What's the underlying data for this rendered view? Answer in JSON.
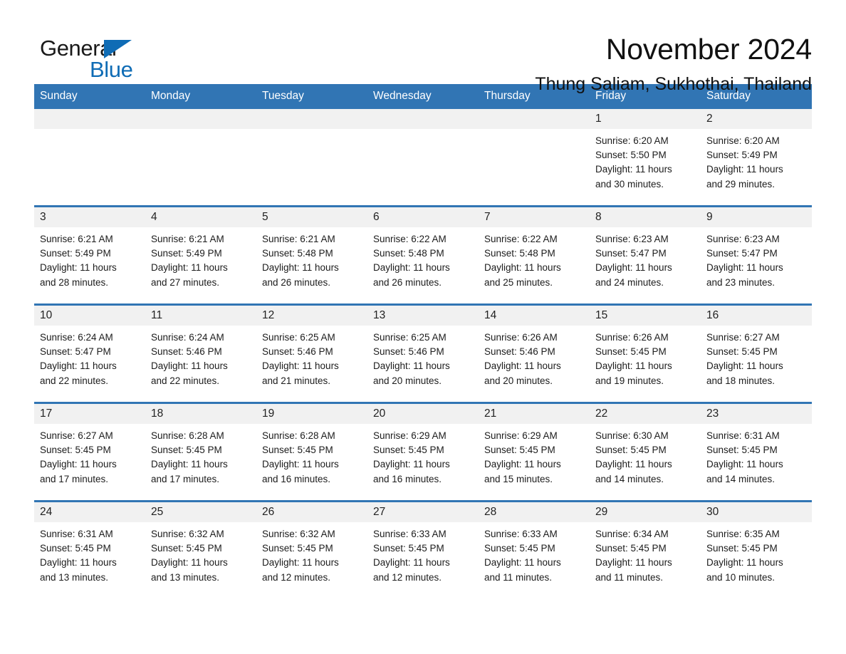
{
  "logo": {
    "word_general": "General",
    "word_blue": "Blue",
    "triangle_color": "#0f6cb5"
  },
  "header": {
    "month_title": "November 2024",
    "location": "Thung Saliam, Sukhothai, Thailand"
  },
  "theme": {
    "header_blue": "#3175b4",
    "daynum_band": "#f1f1f1",
    "row_divider": "#3175b4",
    "text": "#1c1c1c",
    "page_background": "#ffffff"
  },
  "calendar": {
    "weekday_headers": [
      "Sunday",
      "Monday",
      "Tuesday",
      "Wednesday",
      "Thursday",
      "Friday",
      "Saturday"
    ],
    "labels": {
      "sunrise_prefix": "Sunrise:",
      "sunset_prefix": "Sunset:",
      "daylight_prefix": "Daylight:"
    },
    "weeks": [
      [
        {
          "day": "",
          "blank": true
        },
        {
          "day": "",
          "blank": true
        },
        {
          "day": "",
          "blank": true
        },
        {
          "day": "",
          "blank": true
        },
        {
          "day": "",
          "blank": true
        },
        {
          "day": "1",
          "sunrise": "Sunrise: 6:20 AM",
          "sunset": "Sunset: 5:50 PM",
          "daylight_line1": "Daylight: 11 hours",
          "daylight_line2": "and 30 minutes."
        },
        {
          "day": "2",
          "sunrise": "Sunrise: 6:20 AM",
          "sunset": "Sunset: 5:49 PM",
          "daylight_line1": "Daylight: 11 hours",
          "daylight_line2": "and 29 minutes."
        }
      ],
      [
        {
          "day": "3",
          "sunrise": "Sunrise: 6:21 AM",
          "sunset": "Sunset: 5:49 PM",
          "daylight_line1": "Daylight: 11 hours",
          "daylight_line2": "and 28 minutes."
        },
        {
          "day": "4",
          "sunrise": "Sunrise: 6:21 AM",
          "sunset": "Sunset: 5:49 PM",
          "daylight_line1": "Daylight: 11 hours",
          "daylight_line2": "and 27 minutes."
        },
        {
          "day": "5",
          "sunrise": "Sunrise: 6:21 AM",
          "sunset": "Sunset: 5:48 PM",
          "daylight_line1": "Daylight: 11 hours",
          "daylight_line2": "and 26 minutes."
        },
        {
          "day": "6",
          "sunrise": "Sunrise: 6:22 AM",
          "sunset": "Sunset: 5:48 PM",
          "daylight_line1": "Daylight: 11 hours",
          "daylight_line2": "and 26 minutes."
        },
        {
          "day": "7",
          "sunrise": "Sunrise: 6:22 AM",
          "sunset": "Sunset: 5:48 PM",
          "daylight_line1": "Daylight: 11 hours",
          "daylight_line2": "and 25 minutes."
        },
        {
          "day": "8",
          "sunrise": "Sunrise: 6:23 AM",
          "sunset": "Sunset: 5:47 PM",
          "daylight_line1": "Daylight: 11 hours",
          "daylight_line2": "and 24 minutes."
        },
        {
          "day": "9",
          "sunrise": "Sunrise: 6:23 AM",
          "sunset": "Sunset: 5:47 PM",
          "daylight_line1": "Daylight: 11 hours",
          "daylight_line2": "and 23 minutes."
        }
      ],
      [
        {
          "day": "10",
          "sunrise": "Sunrise: 6:24 AM",
          "sunset": "Sunset: 5:47 PM",
          "daylight_line1": "Daylight: 11 hours",
          "daylight_line2": "and 22 minutes."
        },
        {
          "day": "11",
          "sunrise": "Sunrise: 6:24 AM",
          "sunset": "Sunset: 5:46 PM",
          "daylight_line1": "Daylight: 11 hours",
          "daylight_line2": "and 22 minutes."
        },
        {
          "day": "12",
          "sunrise": "Sunrise: 6:25 AM",
          "sunset": "Sunset: 5:46 PM",
          "daylight_line1": "Daylight: 11 hours",
          "daylight_line2": "and 21 minutes."
        },
        {
          "day": "13",
          "sunrise": "Sunrise: 6:25 AM",
          "sunset": "Sunset: 5:46 PM",
          "daylight_line1": "Daylight: 11 hours",
          "daylight_line2": "and 20 minutes."
        },
        {
          "day": "14",
          "sunrise": "Sunrise: 6:26 AM",
          "sunset": "Sunset: 5:46 PM",
          "daylight_line1": "Daylight: 11 hours",
          "daylight_line2": "and 20 minutes."
        },
        {
          "day": "15",
          "sunrise": "Sunrise: 6:26 AM",
          "sunset": "Sunset: 5:45 PM",
          "daylight_line1": "Daylight: 11 hours",
          "daylight_line2": "and 19 minutes."
        },
        {
          "day": "16",
          "sunrise": "Sunrise: 6:27 AM",
          "sunset": "Sunset: 5:45 PM",
          "daylight_line1": "Daylight: 11 hours",
          "daylight_line2": "and 18 minutes."
        }
      ],
      [
        {
          "day": "17",
          "sunrise": "Sunrise: 6:27 AM",
          "sunset": "Sunset: 5:45 PM",
          "daylight_line1": "Daylight: 11 hours",
          "daylight_line2": "and 17 minutes."
        },
        {
          "day": "18",
          "sunrise": "Sunrise: 6:28 AM",
          "sunset": "Sunset: 5:45 PM",
          "daylight_line1": "Daylight: 11 hours",
          "daylight_line2": "and 17 minutes."
        },
        {
          "day": "19",
          "sunrise": "Sunrise: 6:28 AM",
          "sunset": "Sunset: 5:45 PM",
          "daylight_line1": "Daylight: 11 hours",
          "daylight_line2": "and 16 minutes."
        },
        {
          "day": "20",
          "sunrise": "Sunrise: 6:29 AM",
          "sunset": "Sunset: 5:45 PM",
          "daylight_line1": "Daylight: 11 hours",
          "daylight_line2": "and 16 minutes."
        },
        {
          "day": "21",
          "sunrise": "Sunrise: 6:29 AM",
          "sunset": "Sunset: 5:45 PM",
          "daylight_line1": "Daylight: 11 hours",
          "daylight_line2": "and 15 minutes."
        },
        {
          "day": "22",
          "sunrise": "Sunrise: 6:30 AM",
          "sunset": "Sunset: 5:45 PM",
          "daylight_line1": "Daylight: 11 hours",
          "daylight_line2": "and 14 minutes."
        },
        {
          "day": "23",
          "sunrise": "Sunrise: 6:31 AM",
          "sunset": "Sunset: 5:45 PM",
          "daylight_line1": "Daylight: 11 hours",
          "daylight_line2": "and 14 minutes."
        }
      ],
      [
        {
          "day": "24",
          "sunrise": "Sunrise: 6:31 AM",
          "sunset": "Sunset: 5:45 PM",
          "daylight_line1": "Daylight: 11 hours",
          "daylight_line2": "and 13 minutes."
        },
        {
          "day": "25",
          "sunrise": "Sunrise: 6:32 AM",
          "sunset": "Sunset: 5:45 PM",
          "daylight_line1": "Daylight: 11 hours",
          "daylight_line2": "and 13 minutes."
        },
        {
          "day": "26",
          "sunrise": "Sunrise: 6:32 AM",
          "sunset": "Sunset: 5:45 PM",
          "daylight_line1": "Daylight: 11 hours",
          "daylight_line2": "and 12 minutes."
        },
        {
          "day": "27",
          "sunrise": "Sunrise: 6:33 AM",
          "sunset": "Sunset: 5:45 PM",
          "daylight_line1": "Daylight: 11 hours",
          "daylight_line2": "and 12 minutes."
        },
        {
          "day": "28",
          "sunrise": "Sunrise: 6:33 AM",
          "sunset": "Sunset: 5:45 PM",
          "daylight_line1": "Daylight: 11 hours",
          "daylight_line2": "and 11 minutes."
        },
        {
          "day": "29",
          "sunrise": "Sunrise: 6:34 AM",
          "sunset": "Sunset: 5:45 PM",
          "daylight_line1": "Daylight: 11 hours",
          "daylight_line2": "and 11 minutes."
        },
        {
          "day": "30",
          "sunrise": "Sunrise: 6:35 AM",
          "sunset": "Sunset: 5:45 PM",
          "daylight_line1": "Daylight: 11 hours",
          "daylight_line2": "and 10 minutes."
        }
      ]
    ]
  }
}
